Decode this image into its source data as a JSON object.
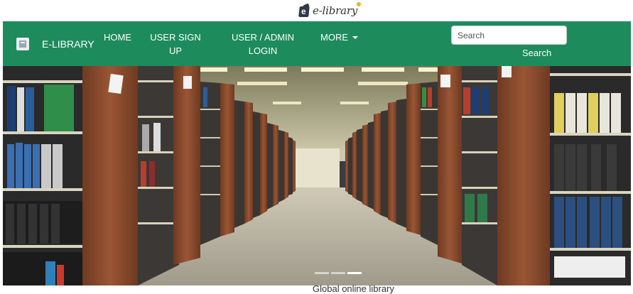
{
  "header": {
    "logo_text": "e-library"
  },
  "navbar": {
    "brand": "E-LIBRARY",
    "items": [
      {
        "label": "HOME"
      },
      {
        "label": "USER SIGN UP"
      },
      {
        "label": "USER / ADMIN LOGIN"
      },
      {
        "label": "MORE"
      }
    ],
    "search": {
      "placeholder": "Search",
      "button_label": "Search"
    }
  },
  "hero": {
    "slides_total": 3,
    "active_slide": 3
  },
  "colors": {
    "navbar": "#1e8b5d",
    "shelf_wood": "#8a4c2c",
    "carpet": "#b7b2a2"
  },
  "footer_text": "Global online library"
}
